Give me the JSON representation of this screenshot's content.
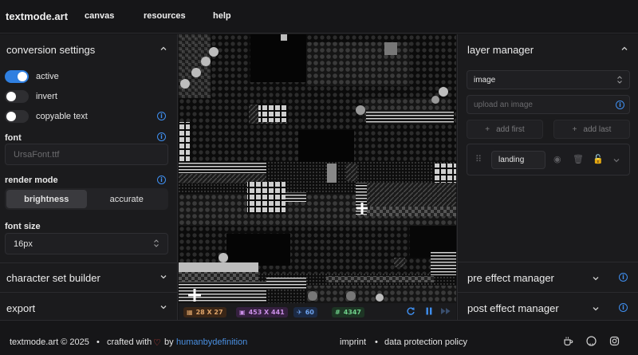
{
  "header": {
    "brand": "textmode.art",
    "nav": [
      "canvas",
      "resources",
      "help"
    ]
  },
  "left_panel": {
    "conversion_settings": {
      "title": "conversion settings",
      "toggles": [
        {
          "label": "active",
          "on": true
        },
        {
          "label": "invert",
          "on": false
        },
        {
          "label": "copyable text",
          "on": false
        }
      ],
      "font_label": "font",
      "font_placeholder": "UrsaFont.ttf",
      "render_mode_label": "render mode",
      "render_modes": [
        "brightness",
        "accurate"
      ],
      "render_mode_selected": "brightness",
      "font_size_label": "font size",
      "font_size_value": "16px"
    },
    "character_set_builder": {
      "title": "character set builder"
    },
    "export": {
      "title": "export"
    }
  },
  "canvas_status": {
    "grid": "28 X 27",
    "resolution": "453 X 441",
    "fps": "60",
    "chars": "4347"
  },
  "right_panel": {
    "layer_manager": {
      "title": "layer manager",
      "type_select": "image",
      "upload_placeholder": "upload an image",
      "add_first": "add first",
      "add_last": "add last",
      "layer_name": "landing"
    },
    "pre_effect_manager": {
      "title": "pre effect manager"
    },
    "post_effect_manager": {
      "title": "post effect manager"
    }
  },
  "footer": {
    "copyright": "textmode.art © 2025",
    "crafted_with": "crafted with",
    "by": "by",
    "author": "humanbydefinition",
    "imprint": "imprint",
    "privacy": "data protection policy"
  },
  "colors": {
    "accent": "#2f7fe0",
    "heart": "#e0443e",
    "link": "#4a90e2"
  }
}
